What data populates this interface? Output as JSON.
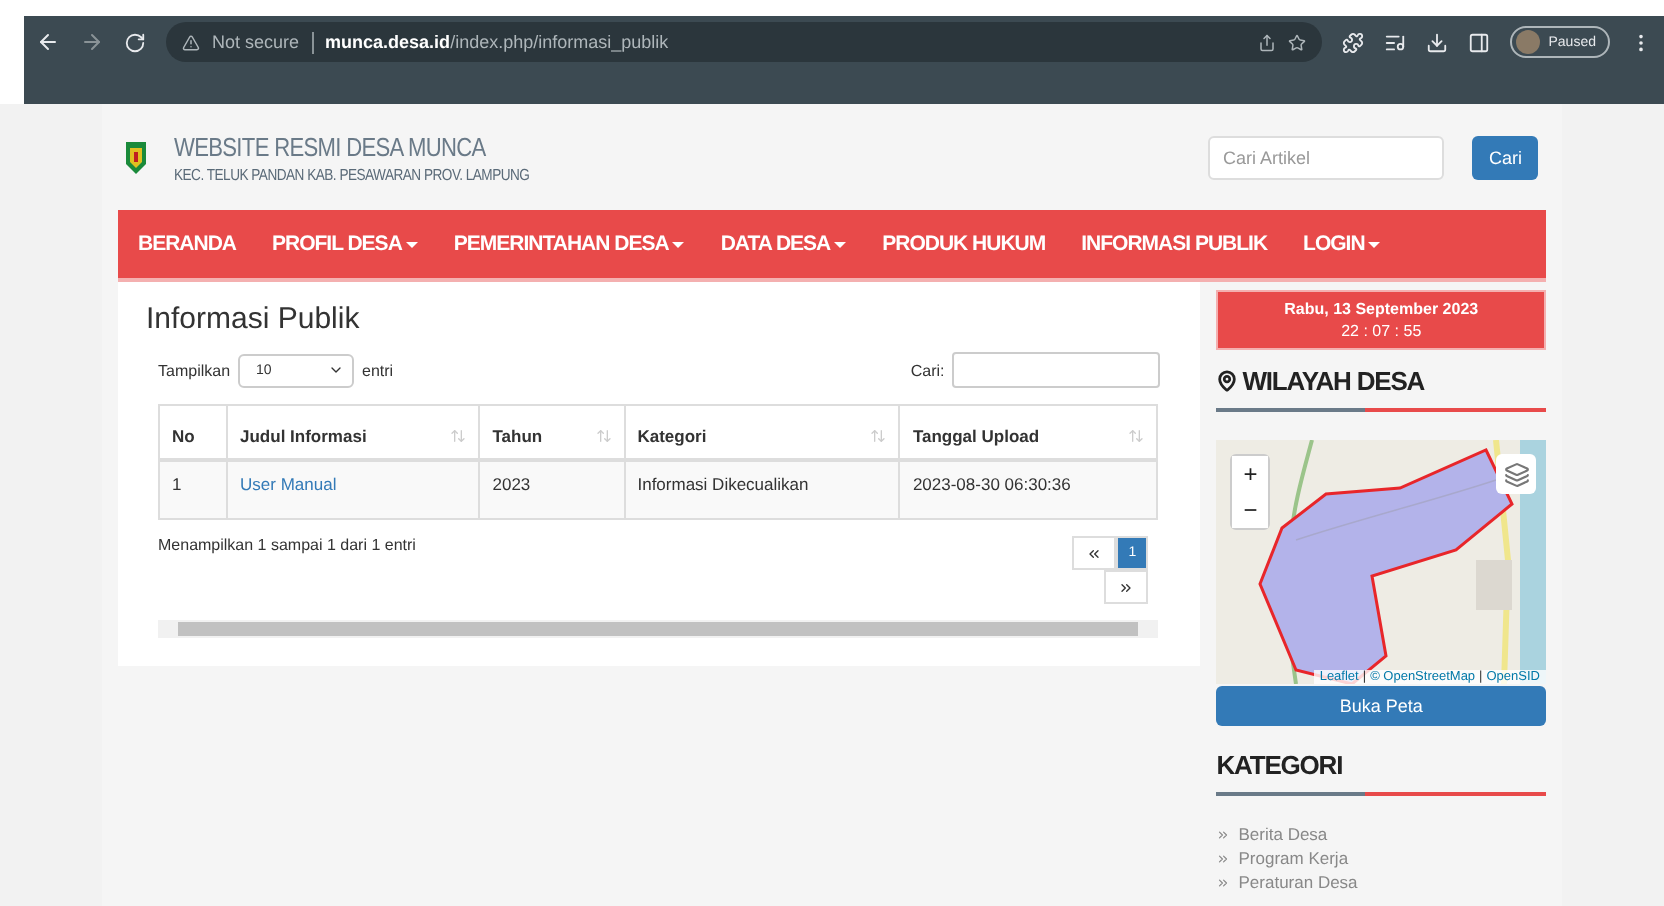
{
  "browser": {
    "security": "Not secure",
    "url": "**munca.desa.id**/index.php/informasi_publik",
    "profile": "Paused"
  },
  "site": {
    "title": "WEBSITE RESMI DESA MUNCA",
    "subtitle": "KEC. TELUK PANDAN KAB. PESAWARAN PROV. LAMPUNG",
    "search": {
      "placeholder": "Cari Artikel",
      "button": "Cari"
    }
  },
  "nav": [
    {
      "label": "BERANDA",
      "dropdown": false
    },
    {
      "label": "PROFIL DESA",
      "dropdown": true
    },
    {
      "label": "PEMERINTAHAN DESA",
      "dropdown": true
    },
    {
      "label": "DATA DESA",
      "dropdown": true
    },
    {
      "label": "PRODUK HUKUM",
      "dropdown": false
    },
    {
      "label": "INFORMASI PUBLIK",
      "dropdown": false
    },
    {
      "label": "LOGIN",
      "dropdown": true
    }
  ],
  "main": {
    "heading": "Informasi Publik",
    "length_before": "Tampilkan",
    "length_value": "10",
    "length_after": "entri",
    "search_label": "Cari:",
    "columns": [
      {
        "label": "No",
        "sortable": false
      },
      {
        "label": "Judul Informasi",
        "sortable": true
      },
      {
        "label": "Tahun",
        "sortable": true
      },
      {
        "label": "Kategori",
        "sortable": true
      },
      {
        "label": "Tanggal Upload",
        "sortable": true
      }
    ],
    "rows": [
      {
        "cells": [
          "1",
          "User Manual",
          "2023",
          "Informasi Dikecualikan",
          "2023-08-30 06:30:36"
        ]
      }
    ],
    "info": "Menampilkan 1 sampai 1 dari 1 entri",
    "pagination": [
      {
        "kind": "prev",
        "selected": false
      },
      {
        "kind": "page",
        "label": "1",
        "selected": true
      },
      {
        "kind": "next",
        "selected": false
      }
    ]
  },
  "sidebar": {
    "date": "Rabu, 13 September 2023",
    "time": "22 : 07 : 55",
    "region_heading": "WILAYAH DESA",
    "map": {
      "zoom_in": "+",
      "zoom_out": "−",
      "attribution": [
        "Leaflet",
        "© OpenStreetMap",
        "OpenSID"
      ],
      "separator": "|"
    },
    "map_button": "Buka Peta",
    "category_heading": "KATEGORI",
    "categories": [
      "Berita Desa",
      "Program Kerja",
      "Peraturan Desa"
    ]
  }
}
